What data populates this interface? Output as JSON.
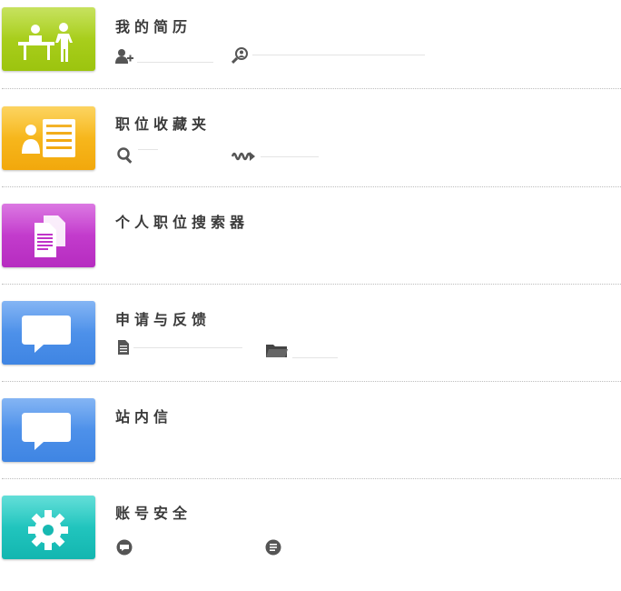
{
  "colors": {
    "resume": "#a6cd17",
    "favorites": "#f6b41a",
    "search": "#c23acb",
    "feedback": "#4a8fe8",
    "messages": "#4a8fe8",
    "security": "#1cc4bd"
  },
  "menu": {
    "items": [
      {
        "title": "我的简历",
        "icon": "people-counter-icon"
      },
      {
        "title": "职位收藏夹",
        "icon": "id-card-icon"
      },
      {
        "title": "个人职位搜索器",
        "icon": "documents-icon"
      },
      {
        "title": "申请与反馈",
        "icon": "chat-bubble-icon"
      },
      {
        "title": "站内信",
        "icon": "chat-bubble-icon"
      },
      {
        "title": "账号安全",
        "icon": "gear-icon"
      }
    ]
  }
}
